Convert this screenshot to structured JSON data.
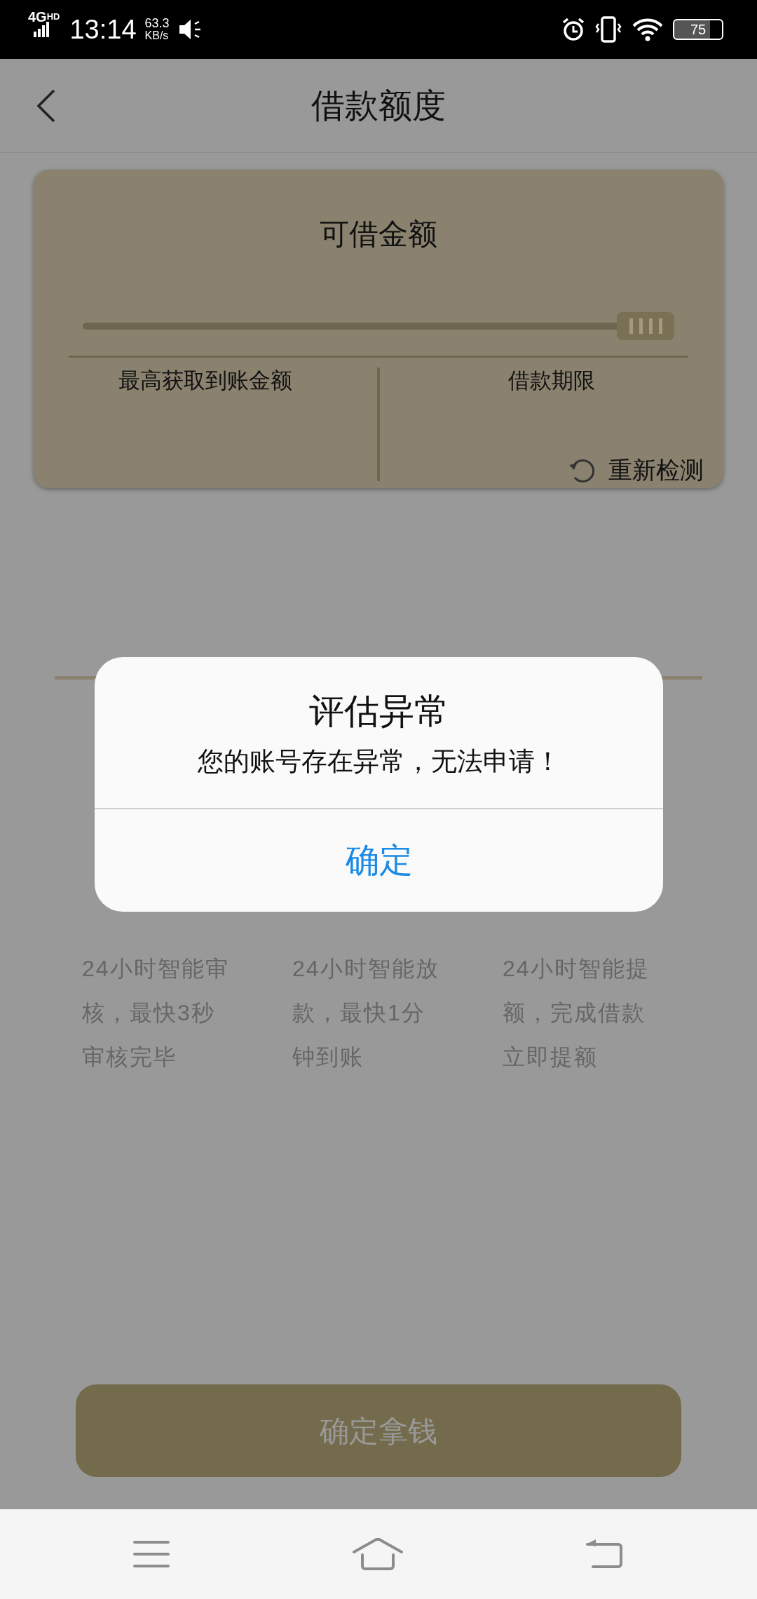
{
  "status_bar": {
    "network": "4G",
    "network_sup": "HD",
    "time": "13:14",
    "speed": "63.3",
    "speed_unit": "KB/s",
    "battery": "75"
  },
  "header": {
    "title": "借款额度"
  },
  "quota_card": {
    "title": "可借金额",
    "slider": {
      "level": 1
    },
    "left_label": "最高获取到账金额",
    "right_label": "借款期限",
    "recheck": "重新检测"
  },
  "steps": [
    {
      "lines": [
        "24小时智能审",
        "核，最快3秒",
        "审核完毕"
      ]
    },
    {
      "lines": [
        "24小时智能放",
        "款，最快1分",
        "钟到账"
      ]
    },
    {
      "lines": [
        "24小时智能提",
        "额，完成借款",
        "立即提额"
      ]
    }
  ],
  "confirm_button": "确定拿钱",
  "dialog": {
    "title": "评估异常",
    "message": "您的账号存在异常，无法申请！",
    "button": "确定"
  }
}
